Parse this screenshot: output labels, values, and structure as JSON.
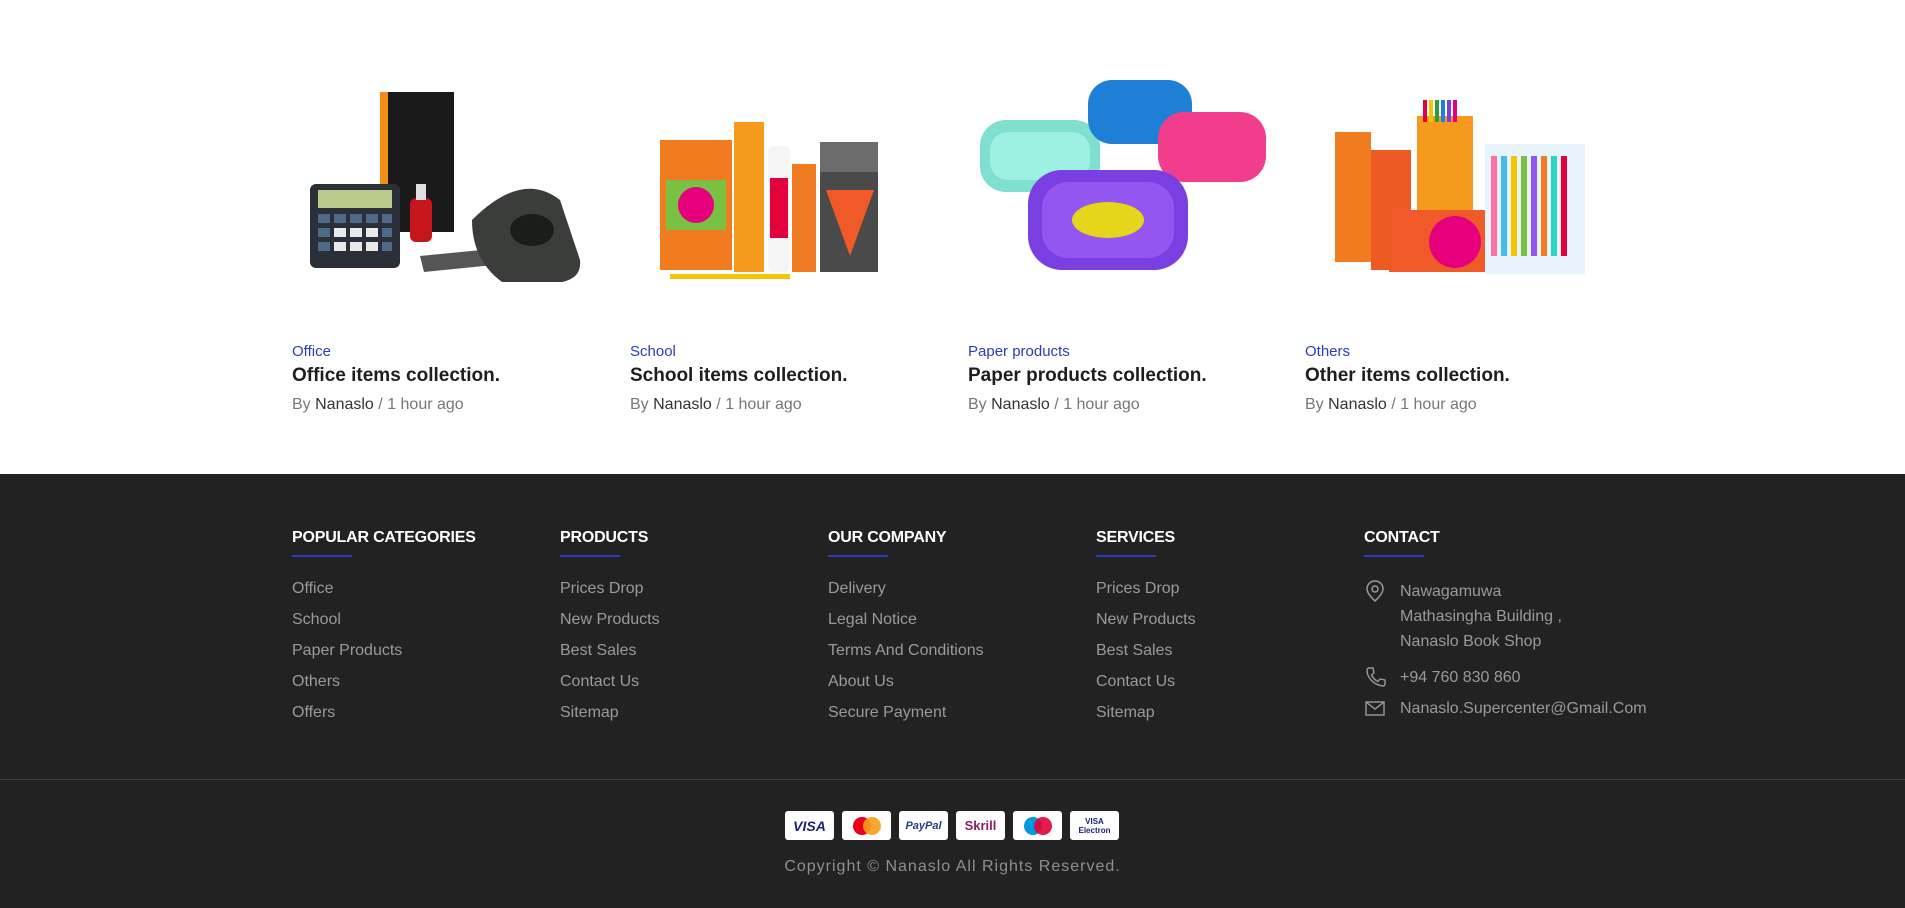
{
  "posts": [
    {
      "category": "Office",
      "title": "Office items collection.",
      "by": "By",
      "author": "Nanaslo",
      "sep": "/",
      "time": "1 hour ago"
    },
    {
      "category": "School",
      "title": "School items collection.",
      "by": "By",
      "author": "Nanaslo",
      "sep": "/",
      "time": "1 hour ago"
    },
    {
      "category": "Paper products",
      "title": "Paper products collection.",
      "by": "By",
      "author": "Nanaslo",
      "sep": "/",
      "time": "1 hour ago"
    },
    {
      "category": "Others",
      "title": "Other items collection.",
      "by": "By",
      "author": "Nanaslo",
      "sep": "/",
      "time": "1 hour ago"
    }
  ],
  "footer": {
    "popular": {
      "heading": "POPULAR CATEGORIES",
      "items": [
        "Office",
        "School",
        "Paper Products",
        "Others",
        "Offers"
      ]
    },
    "products": {
      "heading": "PRODUCTS",
      "items": [
        "Prices Drop",
        "New Products",
        "Best Sales",
        "Contact Us",
        "Sitemap"
      ]
    },
    "company": {
      "heading": "OUR COMPANY",
      "items": [
        "Delivery",
        "Legal Notice",
        "Terms And Conditions",
        "About Us",
        "Secure Payment"
      ]
    },
    "services": {
      "heading": "SERVICES",
      "items": [
        "Prices Drop",
        "New Products",
        "Best Sales",
        "Contact Us",
        "Sitemap"
      ]
    },
    "contact": {
      "heading": "CONTACT",
      "address": [
        "Nawagamuwa",
        "Mathasingha Building ,",
        "Nanaslo Book Shop"
      ],
      "phone": "+94 760 830 860",
      "email": "Nanaslo.Supercenter@Gmail.Com"
    },
    "payments": [
      "VISA",
      "MasterCard",
      "PayPal",
      "Skrill",
      "Maestro",
      "VISA Electron"
    ],
    "copyright": "Copyright © Nanaslo All Rights Reserved."
  },
  "colors": {
    "accent": "#2b3bbd",
    "footer_bg": "#222222"
  },
  "icons": [
    "map-pin-icon",
    "phone-icon",
    "mail-icon"
  ]
}
